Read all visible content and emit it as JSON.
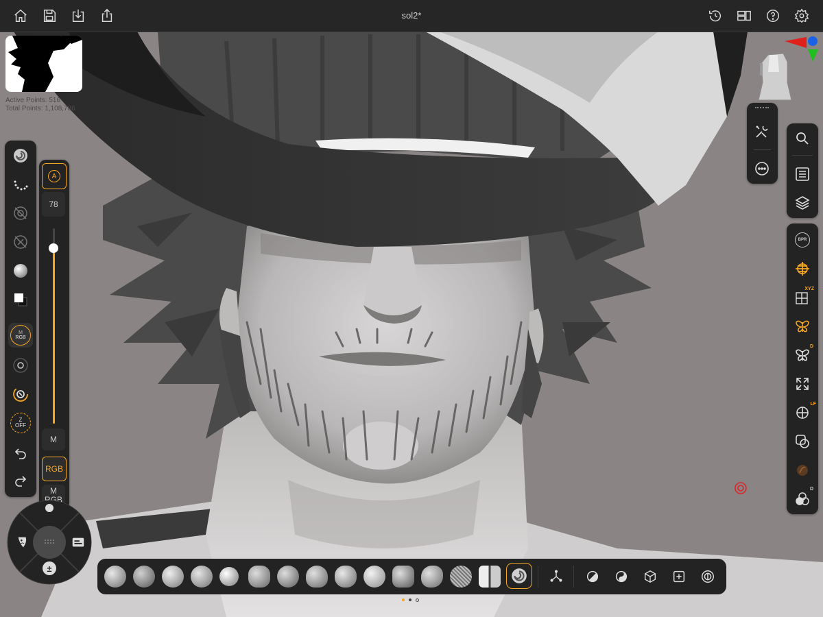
{
  "topbar": {
    "document_title": "sol2*",
    "left_icons": [
      "home-icon",
      "save-icon",
      "import-icon",
      "share-icon"
    ],
    "right_icons": [
      "history-icon",
      "layout-icon",
      "help-icon",
      "settings-icon"
    ]
  },
  "stats": {
    "active_points": "Active Points: 516",
    "total_points": "Total Points: 1,108,786"
  },
  "left_toolbar": {
    "items": [
      "current-brush-icon",
      "stroke-icon",
      "alpha-off-icon",
      "texture-off-icon",
      "material-icon",
      "color-swatch-icon",
      "m-rgb-mode",
      "focal-shift-icon",
      "sculpt-mode-icon",
      "zadd-mode-icon",
      "undo-icon",
      "redo-icon"
    ],
    "m_rgb_small": [
      "M",
      "RGB"
    ],
    "z_off": [
      "Z",
      "OFF"
    ]
  },
  "slider_panel": {
    "auto_label": "A",
    "value": "78",
    "level": 0.9,
    "m_label": "M",
    "rgb_label": "RGB",
    "mrgb_label_top": "M",
    "mrgb_label_bottom": "RGB"
  },
  "gizmo": {
    "axis_colors": {
      "x": "#e0201b",
      "y": "#1fbf1f",
      "z": "#1b63e6"
    }
  },
  "right_upper": {
    "items": [
      "tool-icon",
      "more-icon"
    ]
  },
  "right_toolbar": {
    "group1": [
      "search-icon",
      "subtool-list-icon",
      "layers-icon"
    ],
    "group2": [
      "bpr-icon",
      "transp-icon",
      "floor-grid-icon",
      "symmetry-icon",
      "dynamic-symmetry-icon",
      "frame-icon",
      "local-symmetry-icon",
      "polyframe-icon",
      "solo-icon",
      "dynamic-persp-icon"
    ],
    "bpr_label": "BPR",
    "xyz_label": "XYZ",
    "d_label": "D",
    "lf_label": "LF",
    "d2_label": "D"
  },
  "dial": {
    "items": [
      "mask-icon",
      "smooth-icon",
      "zadd-zsub-icon",
      "gizmo-icon"
    ],
    "zsub_label": "±"
  },
  "brush_bar": {
    "brushes": [
      "current-brush",
      "clay-buildup-brush",
      "standard-brush",
      "clay-brush",
      "inflate-brush",
      "move-brush",
      "dam-standard-brush",
      "hpolish-brush",
      "trim-dynamic-brush",
      "smooth-brush",
      "snakehook-brush",
      "pinch-brush",
      "mask-pen-brush",
      "slice-brush",
      "selected-brush"
    ],
    "tools": [
      "transpose-icon",
      "persp-icon",
      "flat-icon",
      "polyframe-icon",
      "frame-icon",
      "solo-icon"
    ],
    "accent": "#f5a623"
  },
  "colors": {
    "accent": "#f5a623",
    "background": "#8a8584",
    "panel": "#232323",
    "focus_marker": "#d9262b"
  }
}
